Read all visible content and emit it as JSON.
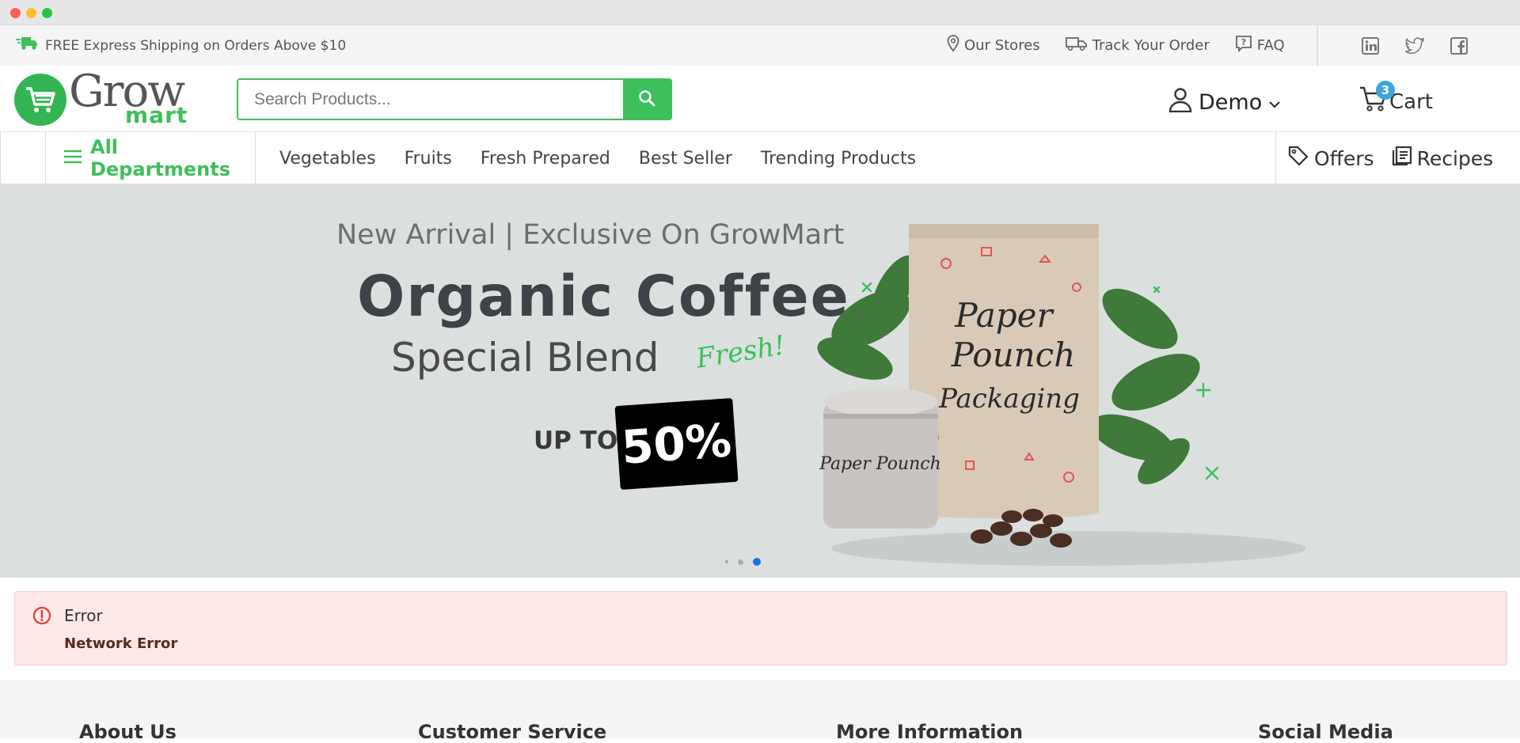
{
  "topbar": {
    "shipping_text": "FREE Express Shipping on Orders Above $10",
    "links": [
      {
        "label": "Our Stores",
        "icon": "map-pin-icon"
      },
      {
        "label": "Track Your Order",
        "icon": "truck-icon"
      },
      {
        "label": "FAQ",
        "icon": "help-icon"
      }
    ],
    "social": [
      "linkedin-icon",
      "twitter-icon",
      "facebook-icon"
    ]
  },
  "header": {
    "logo": {
      "word1": "Grow",
      "word2": "mart"
    },
    "search": {
      "placeholder": "Search Products..."
    },
    "account": {
      "name": "Demo"
    },
    "cart": {
      "label": "Cart",
      "count": "3"
    }
  },
  "nav": {
    "departments_label": "All Departments",
    "items": [
      "Vegetables",
      "Fruits",
      "Fresh Prepared",
      "Best Seller",
      "Trending Products"
    ],
    "offers_label": "Offers",
    "recipes_label": "Recipes"
  },
  "hero": {
    "subtitle": "New Arrival | Exclusive On GrowMart",
    "title": "Organic Coffee",
    "subtitle2": "Special Blend",
    "tag": "Fresh!",
    "upto": "UP TO",
    "discount": "50%",
    "slides": 3,
    "active_slide": 3
  },
  "alert": {
    "title": "Error",
    "message": "Network Error"
  },
  "footer": {
    "columns": [
      "About Us",
      "Customer Service",
      "More Information",
      "Social Media"
    ]
  },
  "colors": {
    "brand_green": "#3dbf5a",
    "badge_blue": "#3da5d9",
    "alert_bg": "#fde8e7",
    "alert_icon": "#e53935"
  }
}
